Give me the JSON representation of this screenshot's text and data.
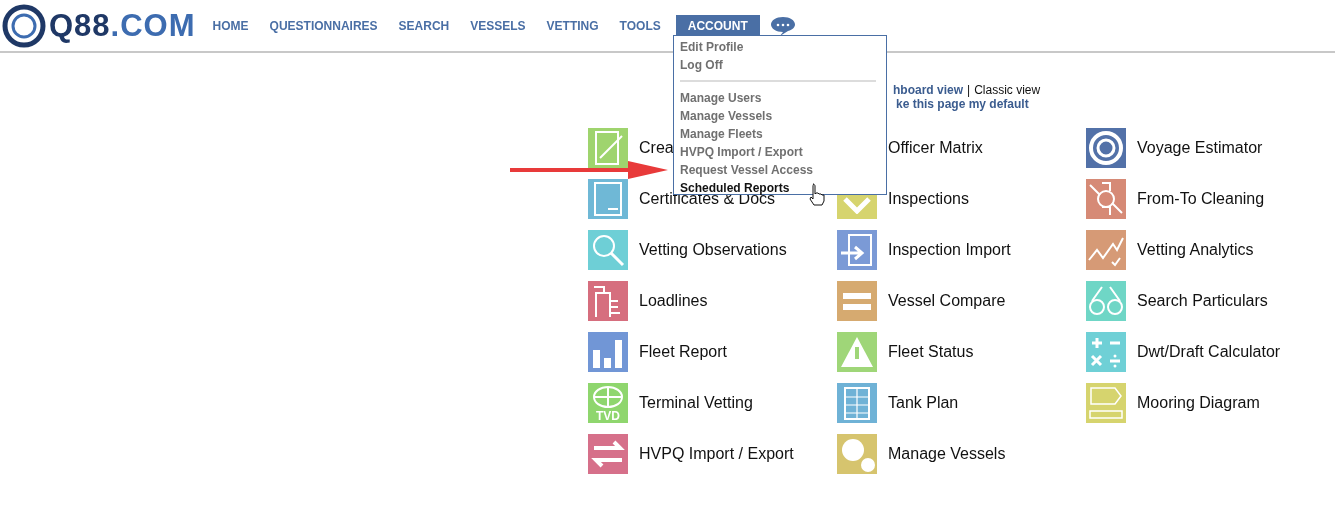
{
  "logo": {
    "brand": "Q88",
    "domain": ".COM"
  },
  "nav": [
    {
      "label": "HOME",
      "selected": false
    },
    {
      "label": "QUESTIONNAIRES",
      "selected": false
    },
    {
      "label": "SEARCH",
      "selected": false
    },
    {
      "label": "VESSELS",
      "selected": false
    },
    {
      "label": "VETTING",
      "selected": false
    },
    {
      "label": "TOOLS",
      "selected": false
    },
    {
      "label": "ACCOUNT",
      "selected": true
    }
  ],
  "account_menu": {
    "groups": [
      [
        {
          "label": "Edit Profile",
          "hovered": false
        },
        {
          "label": "Log Off",
          "hovered": false
        }
      ],
      [
        {
          "label": "Manage Users",
          "hovered": false
        },
        {
          "label": "Manage Vessels",
          "hovered": false
        },
        {
          "label": "Manage Fleets",
          "hovered": false
        },
        {
          "label": "HVPQ Import / Export",
          "hovered": false
        },
        {
          "label": "Request Vessel Access",
          "hovered": false
        },
        {
          "label": "Scheduled Reports",
          "hovered": true
        }
      ]
    ]
  },
  "view_links": {
    "dashboard": "hboard view",
    "separator": "|",
    "classic": "Classic view",
    "default": "ke this page my default"
  },
  "tiles": [
    [
      {
        "label": "Crea",
        "color": "#9fd46e"
      },
      {
        "label": "Certificates & Docs",
        "color": "#6fb8d6"
      },
      {
        "label": "Vetting Observations",
        "color": "#6ecfd6"
      },
      {
        "label": "Loadlines",
        "color": "#d66e7e"
      },
      {
        "label": "Fleet Report",
        "color": "#7196d6"
      },
      {
        "label": "Terminal Vetting",
        "color": "#8fd66e",
        "badge": "TVD"
      },
      {
        "label": "HVPQ Import / Export",
        "color": "#d6708a"
      }
    ],
    [
      {
        "label": "Officer Matrix"
      },
      {
        "label": "Inspections",
        "color": "#d6d46e"
      },
      {
        "label": "Inspection Import",
        "color": "#7b9ad6"
      },
      {
        "label": "Vessel Compare",
        "color": "#d6aa70"
      },
      {
        "label": "Fleet Status",
        "color": "#9fd678"
      },
      {
        "label": "Tank Plan",
        "color": "#6fb2d6"
      },
      {
        "label": "Manage Vessels",
        "color": "#d6c46e"
      }
    ],
    [
      {
        "label": "Voyage Estimator",
        "color": "#5271a8"
      },
      {
        "label": "From-To Cleaning",
        "color": "#d68a76"
      },
      {
        "label": "Vetting Analytics",
        "color": "#d69a76"
      },
      {
        "label": "Search Particulars",
        "color": "#6fd6c6"
      },
      {
        "label": "Dwt/Draft Calculator",
        "color": "#6fd0d6"
      },
      {
        "label": "Mooring Diagram",
        "color": "#d6d46e"
      }
    ]
  ]
}
